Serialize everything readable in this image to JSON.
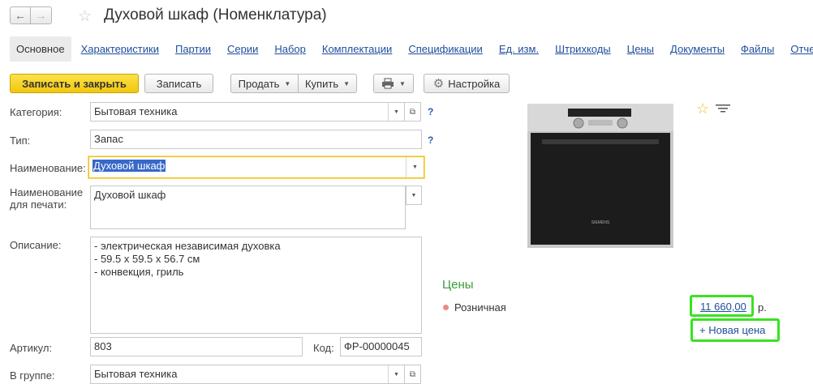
{
  "window": {
    "title": "Духовой шкаф (Номенклатура)",
    "nav_back": "←",
    "nav_forward": "→",
    "favorite_icon": "star-outline-icon"
  },
  "tabs": [
    {
      "label": "Основное",
      "active": true
    },
    {
      "label": "Характеристики"
    },
    {
      "label": "Партии"
    },
    {
      "label": "Серии"
    },
    {
      "label": "Набор"
    },
    {
      "label": "Комплектации"
    },
    {
      "label": "Спецификации"
    },
    {
      "label": "Ед. изм."
    },
    {
      "label": "Штрихкоды"
    },
    {
      "label": "Цены"
    },
    {
      "label": "Документы"
    },
    {
      "label": "Файлы"
    },
    {
      "label": "Отчеты"
    }
  ],
  "toolbar": {
    "save_close": "Записать и закрыть",
    "save": "Записать",
    "sell": "Продать",
    "buy": "Купить",
    "settings": "Настройка",
    "print_icon": "printer-icon",
    "settings_icon": "gear-icon"
  },
  "form": {
    "category_label": "Категория:",
    "category_value": "Бытовая техника",
    "type_label": "Тип:",
    "type_value": "Запас",
    "name_label": "Наименование:",
    "name_value": "Духовой шкаф",
    "print_name_label_1": "Наименование",
    "print_name_label_2": "для печати:",
    "print_name_value": "Духовой шкаф",
    "description_label": "Описание:",
    "description_lines": [
      "- электрическая независимая духовка",
      "- 59.5 х 59.5 х 56.7 см",
      "- конвекция, гриль"
    ],
    "article_label": "Артикул:",
    "article_value": "803",
    "code_label": "Код:",
    "code_value": "ФР-00000045",
    "group_label": "В группе:",
    "group_value": "Бытовая техника",
    "help_mark": "?"
  },
  "image": {
    "brand": "SIEMENS"
  },
  "prices": {
    "title": "Цены",
    "kind": "Розничная",
    "value": "11 660,00",
    "currency": "р.",
    "new_price": "+ Новая цена"
  },
  "colors": {
    "accent_yellow": "#f2c60d",
    "link_blue": "#1f4e9c",
    "prices_green": "#3a9b3a",
    "highlight_green": "#39e221"
  }
}
